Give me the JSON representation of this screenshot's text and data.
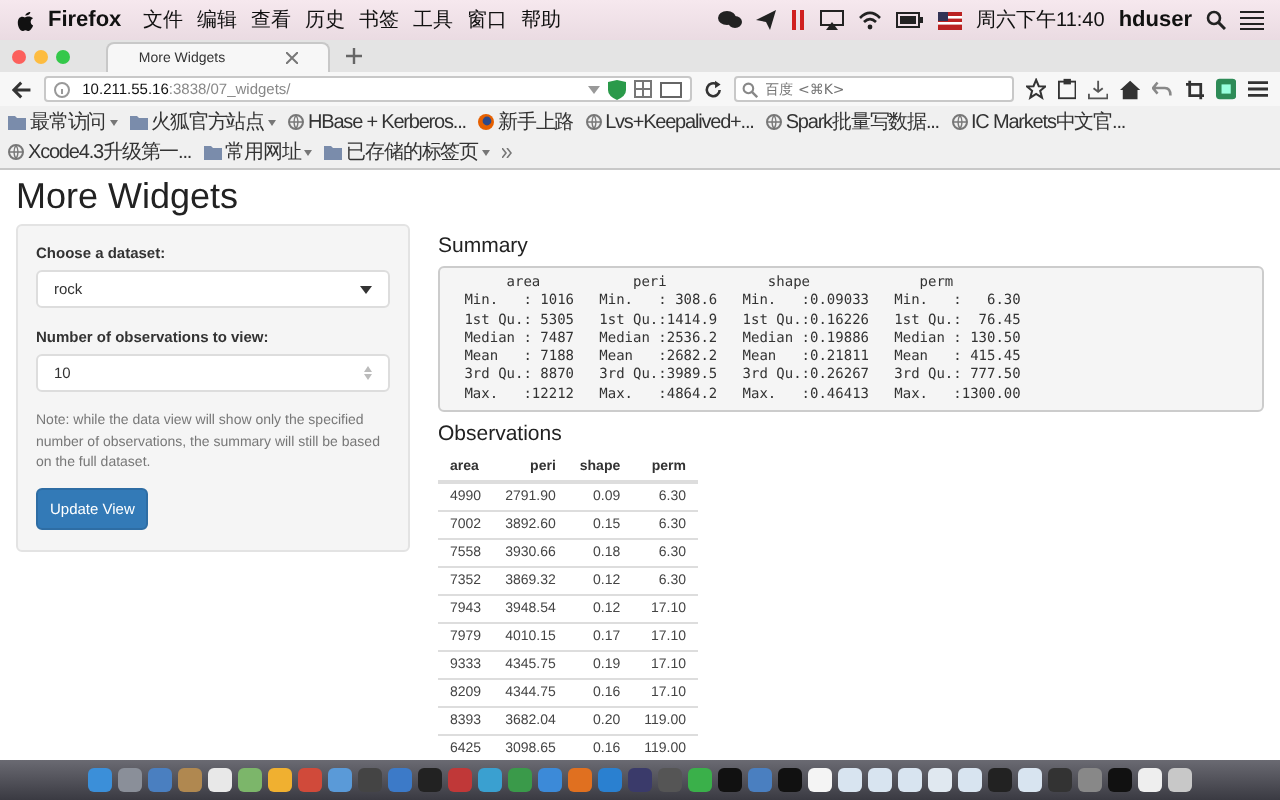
{
  "menu_bar": {
    "app": "Firefox",
    "items": [
      "文件",
      "编辑",
      "查看",
      "历史",
      "书签",
      "工具",
      "窗口",
      "帮助"
    ],
    "clock": "周六下午11:40",
    "user": "hduser"
  },
  "tabs": [
    {
      "label": "More Widgets",
      "selected": true
    }
  ],
  "address_bar": {
    "host": "10.211.55.16",
    "path": ":3838/07_widgets/",
    "search_placeholder": "百度 <⌘K>"
  },
  "bookmarks": [
    {
      "label": "最常访问",
      "kind": "folder",
      "dropdown": true
    },
    {
      "label": "火狐官方站点",
      "kind": "folder",
      "dropdown": true
    },
    {
      "label": "HBase + Kerberos...",
      "kind": "site",
      "dropdown": false
    },
    {
      "label": "新手上路",
      "kind": "firefox",
      "dropdown": false
    },
    {
      "label": "Lvs+Keepalived+...",
      "kind": "site",
      "dropdown": false
    },
    {
      "label": "Spark批量写数据...",
      "kind": "site",
      "dropdown": false
    },
    {
      "label": "IC Markets中文官...",
      "kind": "site",
      "dropdown": false
    },
    {
      "label": "Xcode4.3升级第一...",
      "kind": "site",
      "dropdown": false
    },
    {
      "label": "常用网址",
      "kind": "folder",
      "dropdown": true
    },
    {
      "label": "已存储的标签页",
      "kind": "folder",
      "dropdown": true
    }
  ],
  "page": {
    "title": "More Widgets",
    "sidebar": {
      "dataset_label": "Choose a dataset:",
      "dataset_value": "rock",
      "obs_label": "Number of observations to view:",
      "obs_value": "10",
      "note": "Note: while the data view will show only the specified number of observations, the summary will still be based on the full dataset.",
      "button": "Update View"
    },
    "summary": {
      "heading": "Summary",
      "lines": [
        "      area           peri            shape             perm        ",
        " Min.   : 1016   Min.   : 308.6   Min.   :0.09033   Min.   :   6.30  ",
        " 1st Qu.: 5305   1st Qu.:1414.9   1st Qu.:0.16226   1st Qu.:  76.45  ",
        " Median : 7487   Median :2536.2   Median :0.19886   Median : 130.50  ",
        " Mean   : 7188   Mean   :2682.2   Mean   :0.21811   Mean   : 415.45  ",
        " 3rd Qu.: 8870   3rd Qu.:3989.5   3rd Qu.:0.26267   3rd Qu.: 777.50  ",
        " Max.   :12212   Max.   :4864.2   Max.   :0.46413   Max.   :1300.00  "
      ]
    },
    "observations": {
      "heading": "Observations",
      "columns": [
        "area",
        "peri",
        "shape",
        "perm"
      ],
      "rows": [
        [
          "4990",
          "2791.90",
          "0.09",
          "6.30"
        ],
        [
          "7002",
          "3892.60",
          "0.15",
          "6.30"
        ],
        [
          "7558",
          "3930.66",
          "0.18",
          "6.30"
        ],
        [
          "7352",
          "3869.32",
          "0.12",
          "6.30"
        ],
        [
          "7943",
          "3948.54",
          "0.12",
          "17.10"
        ],
        [
          "7979",
          "4010.15",
          "0.17",
          "17.10"
        ],
        [
          "9333",
          "4345.75",
          "0.19",
          "17.10"
        ],
        [
          "8209",
          "4344.75",
          "0.16",
          "17.10"
        ],
        [
          "8393",
          "3682.04",
          "0.20",
          "119.00"
        ],
        [
          "6425",
          "3098.65",
          "0.16",
          "119.00"
        ]
      ]
    }
  }
}
